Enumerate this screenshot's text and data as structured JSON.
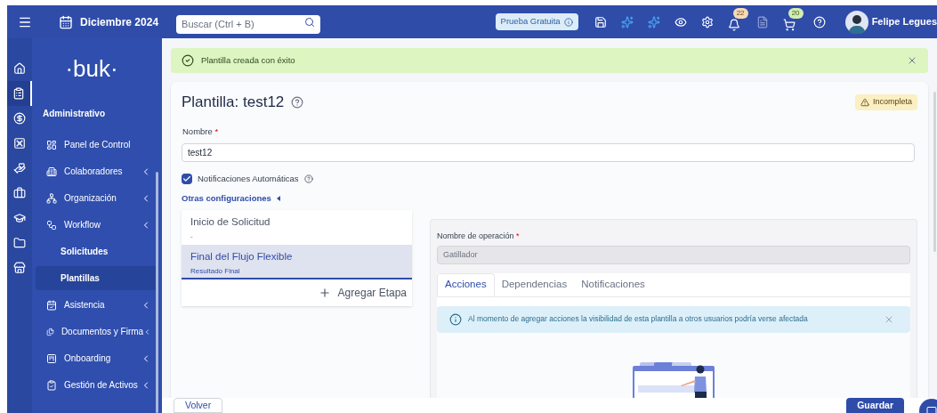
{
  "topbar": {
    "date": "Diciembre 2024",
    "search": {
      "placeholder": "Buscar (Ctrl + B)"
    },
    "trial_badge": "Prueba Gratuita",
    "notifications_count": "22",
    "cart_count": "20",
    "user_name": "Felipe Legues"
  },
  "sidebar": {
    "logo": "·buk·",
    "section": "Administrativo",
    "items": [
      {
        "label": "Panel de Control",
        "kind": "item",
        "expandable": false,
        "selected": false
      },
      {
        "label": "Colaboradores",
        "kind": "item",
        "expandable": true,
        "selected": false
      },
      {
        "label": "Organización",
        "kind": "item",
        "expandable": true,
        "selected": false
      },
      {
        "label": "Workflow",
        "kind": "item",
        "expandable": true,
        "selected": false
      },
      {
        "label": "Solicitudes",
        "kind": "subitem",
        "expandable": false,
        "selected": false
      },
      {
        "label": "Plantillas",
        "kind": "subitem",
        "expandable": false,
        "selected": true
      },
      {
        "label": "Asistencia",
        "kind": "item",
        "expandable": true,
        "selected": false
      },
      {
        "label": "Documentos y Firma",
        "kind": "item",
        "expandable": true,
        "selected": false
      },
      {
        "label": "Onboarding",
        "kind": "item",
        "expandable": true,
        "selected": false
      },
      {
        "label": "Gestión de Activos",
        "kind": "item",
        "expandable": true,
        "selected": false
      }
    ]
  },
  "alert": {
    "message": "Plantilla creada con éxito"
  },
  "template": {
    "title": "Plantilla: test12",
    "status": "Incompleta",
    "name_label": "Nombre",
    "name_required_mark": "*",
    "name_value": "test12",
    "auto_notifications": {
      "label": "Notificaciones Automáticas",
      "checked": true
    },
    "other_settings": "Otras configuraciones",
    "stages": [
      {
        "title": "Inicio de Solicitud",
        "subtitle": "-",
        "selected": false
      },
      {
        "title": "Final del Flujo Flexible",
        "subtitle": "Resultado Final",
        "selected": true
      }
    ],
    "add_stage": "Agregar Etapa",
    "operation": {
      "label": "Nombre de operación",
      "required_mark": "*",
      "value": "Gatillador",
      "tabs": [
        {
          "label": "Acciones",
          "selected": true
        },
        {
          "label": "Dependencias",
          "selected": false
        },
        {
          "label": "Notificaciones",
          "selected": false
        }
      ],
      "info": "Al momento de agregar acciones la visibilidad de esta plantilla a otros usuarios podría verse afectada"
    }
  },
  "footer": {
    "back": "Volver",
    "save": "Guardar"
  }
}
